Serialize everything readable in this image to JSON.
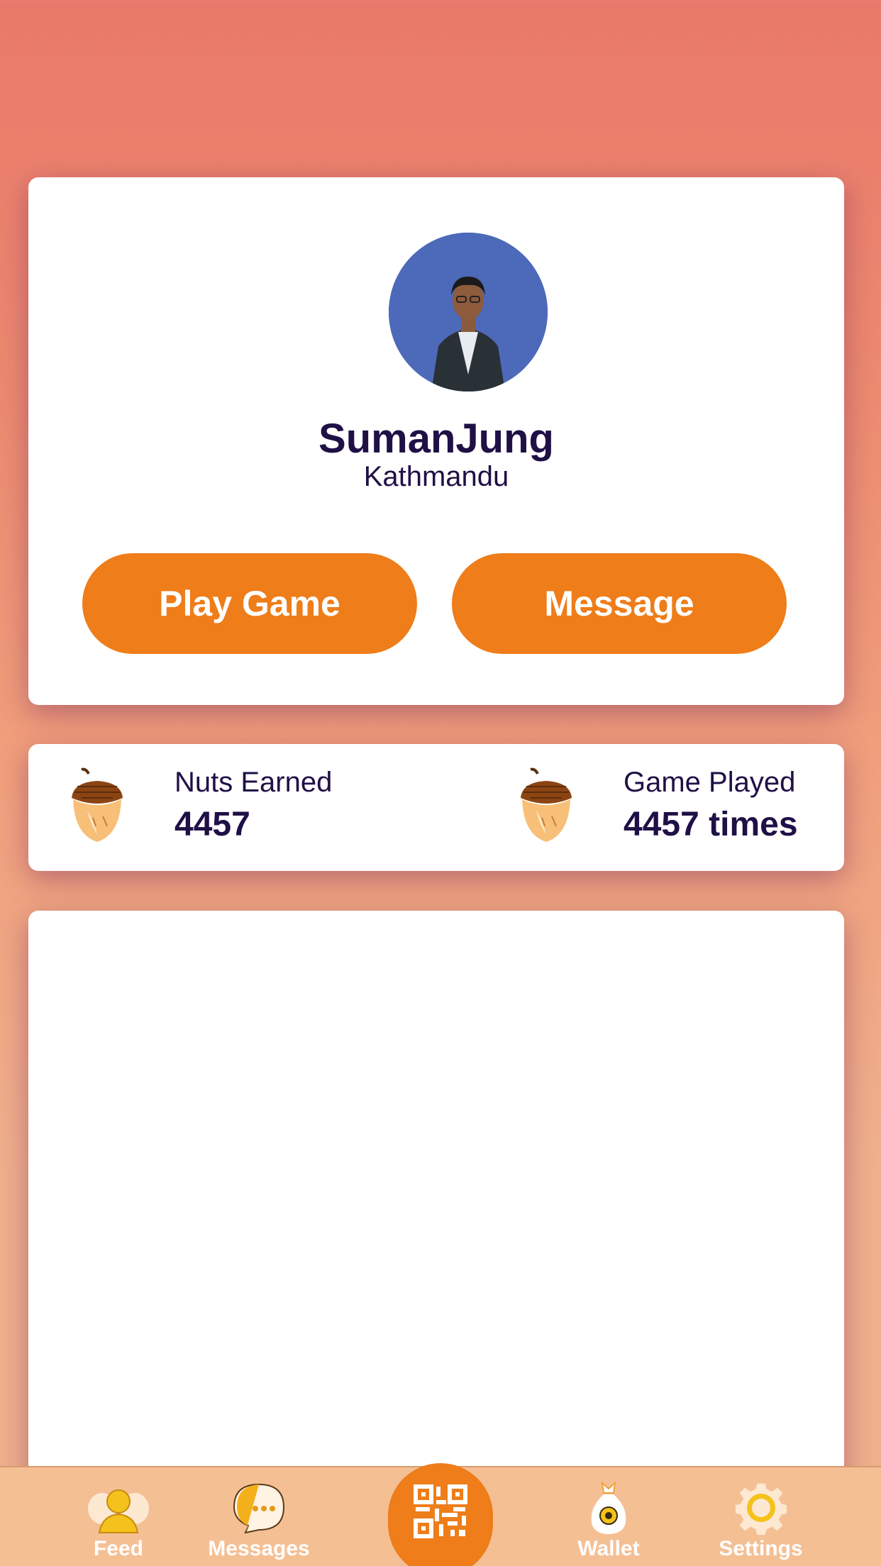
{
  "profile": {
    "name": "SumanJung",
    "city": "Kathmandu",
    "play_label": "Play Game",
    "message_label": "Message",
    "avatar_icon": "profile-photo"
  },
  "stats": {
    "nuts": {
      "label": "Nuts Earned",
      "value": "4457",
      "icon": "acorn-icon"
    },
    "games": {
      "label": "Game Played",
      "value": "4457 times",
      "icon": "acorn-icon"
    }
  },
  "tabbar": {
    "items": [
      {
        "label": "Feed",
        "icon": "feed-icon"
      },
      {
        "label": "Messages",
        "icon": "messages-icon"
      },
      {
        "label": "Wallet",
        "icon": "wallet-icon"
      },
      {
        "label": "Settings",
        "icon": "settings-icon"
      }
    ],
    "center_icon": "qr-code-icon"
  },
  "colors": {
    "accent": "#ee7d1a",
    "text": "#1f1046",
    "tabbar": "#f5bf94"
  }
}
